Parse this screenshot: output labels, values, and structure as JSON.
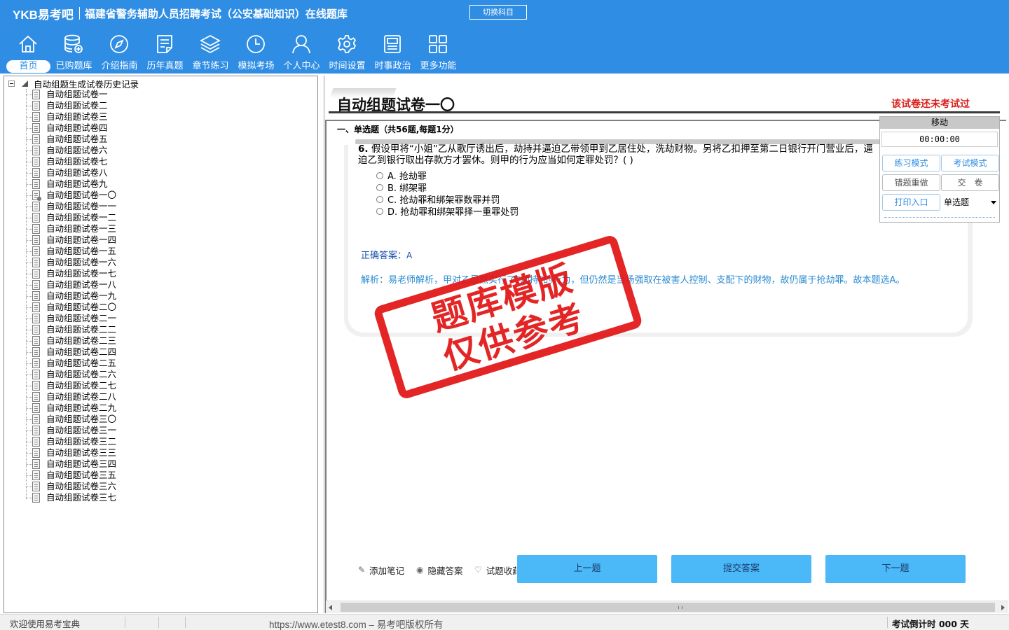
{
  "header": {
    "logo": "YKB易考吧",
    "title": "福建省警务辅助人员招聘考试（公安基础知识）在线题库",
    "switch_subject": "切换科目",
    "nav": [
      {
        "label": "首页",
        "icon": "home-icon"
      },
      {
        "label": "已购题库",
        "icon": "database-icon"
      },
      {
        "label": "介绍指南",
        "icon": "compass-icon"
      },
      {
        "label": "历年真题",
        "icon": "document-list-icon"
      },
      {
        "label": "章节练习",
        "icon": "layers-icon"
      },
      {
        "label": "模拟考场",
        "icon": "clock-icon"
      },
      {
        "label": "个人中心",
        "icon": "user-icon"
      },
      {
        "label": "时间设置",
        "icon": "gear-icon"
      },
      {
        "label": "时事政治",
        "icon": "newspaper-icon"
      },
      {
        "label": "更多功能",
        "icon": "grid-icon"
      }
    ]
  },
  "tree": {
    "root": "自动组题生成试卷历史记录",
    "items": [
      "自动组题试卷一",
      "自动组题试卷二",
      "自动组题试卷三",
      "自动组题试卷四",
      "自动组题试卷五",
      "自动组题试卷六",
      "自动组题试卷七",
      "自动组题试卷八",
      "自动组题试卷九",
      "自动组题试卷一〇",
      "自动组题试卷一一",
      "自动组题试卷一二",
      "自动组题试卷一三",
      "自动组题试卷一四",
      "自动组题试卷一五",
      "自动组题试卷一六",
      "自动组题试卷一七",
      "自动组题试卷一八",
      "自动组题试卷一九",
      "自动组题试卷二〇",
      "自动组题试卷二一",
      "自动组题试卷二二",
      "自动组题试卷二三",
      "自动组题试卷二四",
      "自动组题试卷二五",
      "自动组题试卷二六",
      "自动组题试卷二七",
      "自动组题试卷二八",
      "自动组题试卷二九",
      "自动组题试卷三〇",
      "自动组题试卷三一",
      "自动组题试卷三二",
      "自动组题试卷三三",
      "自动组题试卷三四",
      "自动组题试卷三五",
      "自动组题试卷三六",
      "自动组题试卷三七"
    ],
    "selected_index": 9
  },
  "paper": {
    "title": "自动组题试卷一〇",
    "status": "该试卷还未考试过",
    "section": "一、单选题（共56题,每题1分）"
  },
  "question": {
    "number": "6.",
    "text": "假设甲将“小姐”乙从歌厅诱出后，劫持并逼迫乙带领甲到乙居住处，洗劫财物。另将乙扣押至第二日银行开门营业后，逼迫乙到银行取出存款方才罢休。则甲的行为应当如何定罪处罚？( )",
    "options": [
      "A. 抢劫罪",
      "B. 绑架罪",
      "C. 抢劫罪和绑架罪数罪并罚",
      "D. 抢劫罪和绑架罪择一重罪处罚"
    ],
    "answer_label": "正确答案：",
    "answer_value": "A",
    "analysis": "解析：易老师解析，甲对乙虽然实行了“劫持”的行为，但仍然是当场强取在被害人控制、支配下的财物，故仍属于抢劫罪。故本题选A。"
  },
  "float_panel": {
    "head": "移动",
    "timer": "00:00:00",
    "practice_mode": "练习模式",
    "exam_mode": "考试模式",
    "redo_wrong": "错题重做",
    "submit_paper": "交　卷",
    "print_entry": "打印入口",
    "question_type": "单选题"
  },
  "tools": {
    "add_note": "添加笔记",
    "hide_answer": "隐藏答案",
    "favorite": "试题收藏"
  },
  "buttons": {
    "prev": "上一题",
    "submit": "提交答案",
    "next": "下一题"
  },
  "watermark": {
    "line1": "题库模版",
    "line2": "仅供参考"
  },
  "statusbar": {
    "welcome": "欢迎使用易考宝典",
    "site": "https://www.etest8.com – 易考吧版权所有",
    "countdown": "考试倒计时 000 天"
  },
  "colors": {
    "header_bg": "#2f8de4",
    "button_bg": "#4bb8f8",
    "status_red": "#d8201c",
    "analysis_blue": "#2a8bd0",
    "stamp_red": "#e21515"
  }
}
